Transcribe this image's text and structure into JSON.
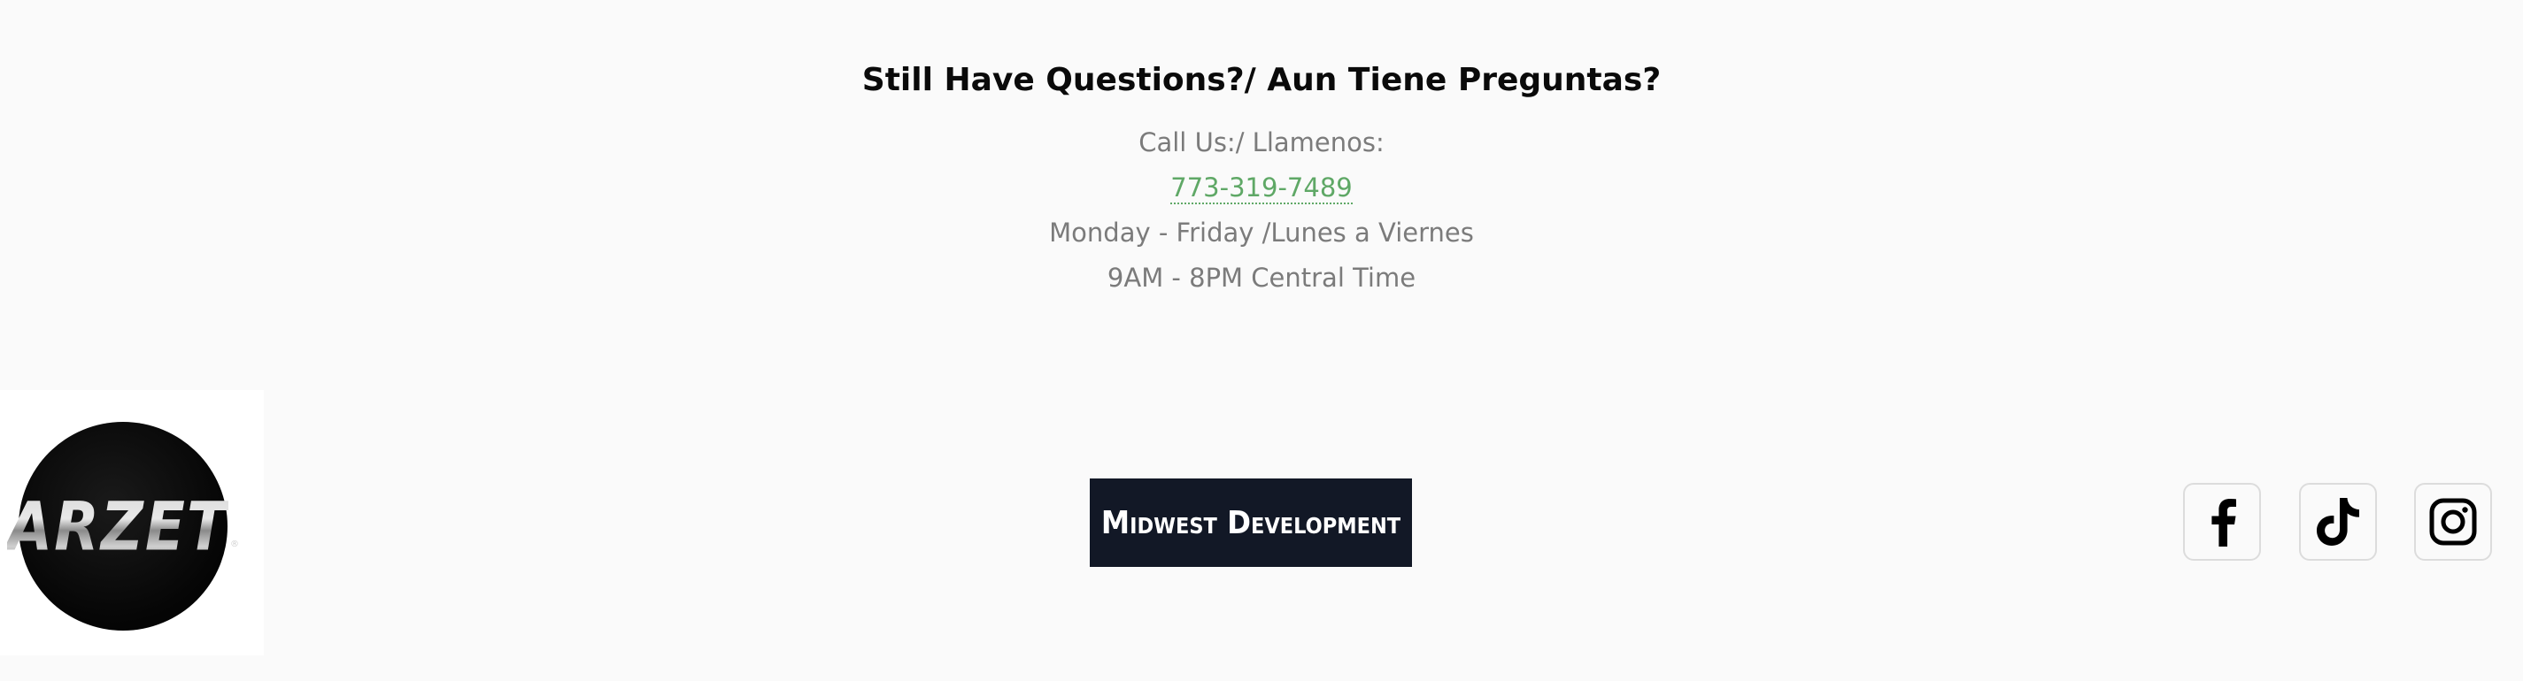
{
  "contact": {
    "heading": "Still Have Questions?/ Aun Tiene Preguntas?",
    "call_label": "Call Us:/ Llamenos:",
    "phone": "773-319-7489",
    "days": "Monday - Friday /Lunes a Viernes",
    "hours": "9AM - 8PM Central Time",
    "link_color": "#5fa866"
  },
  "footer": {
    "logo_text": "ARZET",
    "logo_mark": "®",
    "brand_button_label": "Midwest Development",
    "brand_button_color": "#121826",
    "social_links": [
      {
        "name": "Facebook",
        "icon": "facebook-icon"
      },
      {
        "name": "TikTok",
        "icon": "tiktok-icon"
      },
      {
        "name": "Instagram",
        "icon": "instagram-icon"
      }
    ]
  }
}
